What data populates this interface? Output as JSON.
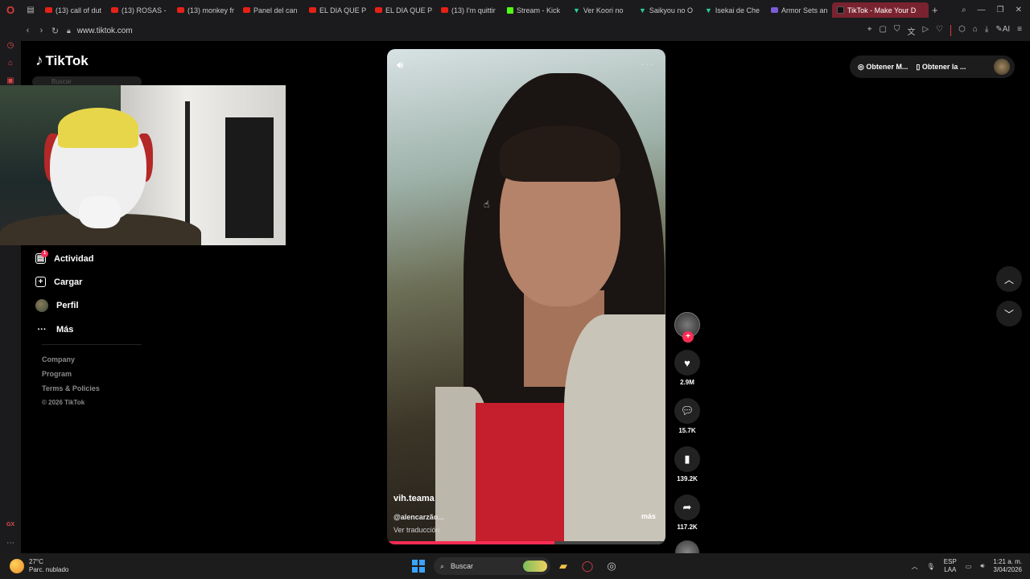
{
  "browser": {
    "tabs": [
      {
        "label": "(13) call of dut",
        "icon": "youtube-icon"
      },
      {
        "label": "(13) ROSAS -",
        "icon": "youtube-icon"
      },
      {
        "label": "(13) monkey fr",
        "icon": "youtube-icon"
      },
      {
        "label": "Panel del can",
        "icon": "youtube-icon"
      },
      {
        "label": "EL DIA QUE P",
        "icon": "youtube-icon"
      },
      {
        "label": "EL DIA QUE P",
        "icon": "youtube-icon"
      },
      {
        "label": "(13) I'm quittir",
        "icon": "youtube-icon"
      },
      {
        "label": "Stream - Kick",
        "icon": "kick-icon"
      },
      {
        "label": "Ver Koori no",
        "icon": "v-icon"
      },
      {
        "label": "Saikyou no O",
        "icon": "v-icon"
      },
      {
        "label": "Isekai de Che",
        "icon": "v-icon"
      },
      {
        "label": "Armor Sets an",
        "icon": "generic-icon"
      },
      {
        "label": "TikTok - Make Your D",
        "icon": "tiktok-icon",
        "active": true
      }
    ],
    "url": "www.tiktok.com",
    "ai_label": "AI"
  },
  "tiktok": {
    "logo_text": "TikTok",
    "search_placeholder": "Buscar",
    "nav": [
      {
        "label": "Actividad",
        "icon": "inbox-icon",
        "badge": "1"
      },
      {
        "label": "Cargar",
        "icon": "upload-icon"
      },
      {
        "label": "Perfil",
        "icon": "profile-avatar"
      },
      {
        "label": "Más",
        "icon": "more-icon"
      }
    ],
    "footer": [
      "Company",
      "Program",
      "Terms & Policies"
    ],
    "copyright": "© 2026 TikTok",
    "top_buttons": [
      "Obtener M...",
      "Obtener la ..."
    ],
    "video": {
      "username": "vih.teama",
      "mention": "@alencarzão...",
      "translate": "Ver traducción",
      "more": "más",
      "progress_fraction": 0.6
    },
    "actions": {
      "likes": "2.9M",
      "comments": "15.7K",
      "saves": "139.2K",
      "shares": "117.2K"
    }
  },
  "taskbar": {
    "temperature": "27°C",
    "weather": "Parc. nublado",
    "search": "Buscar",
    "lang_top": "ESP",
    "lang_bottom": "LAA",
    "time": "1:21 a. m.",
    "date": "3/04/2026"
  }
}
